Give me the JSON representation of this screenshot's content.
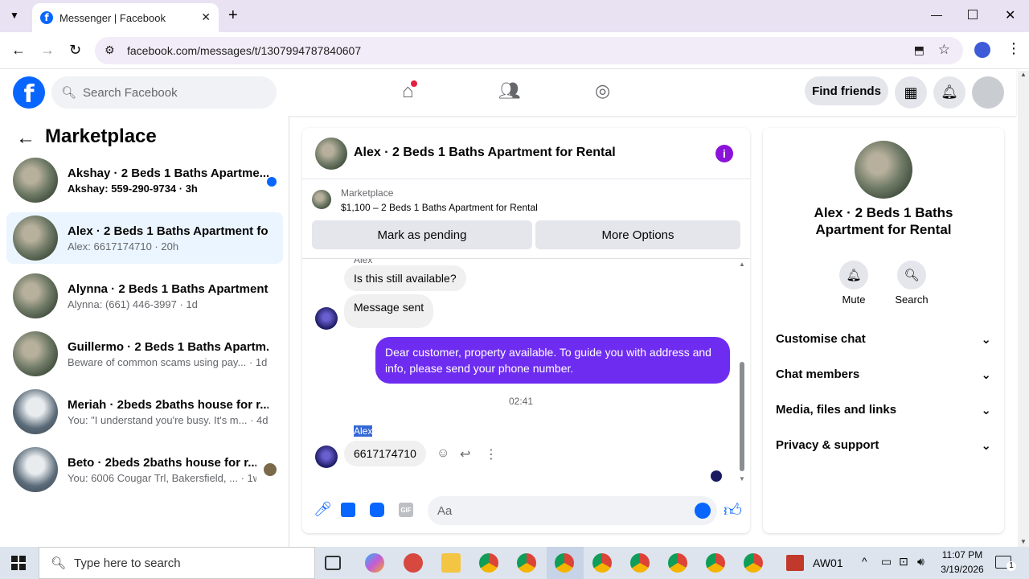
{
  "browser": {
    "tab_title": "Messenger | Facebook",
    "url": "facebook.com/messages/t/1307994787840607"
  },
  "fb": {
    "search_placeholder": "Search Facebook",
    "find_friends": "Find friends"
  },
  "left": {
    "title": "Marketplace",
    "conversations": [
      {
        "name": "Akshay · 2 Beds 1 Baths Apartme...",
        "preview": "Akshay: 559-290-9734 · 3h",
        "unread": true
      },
      {
        "name": "Alex · 2 Beds 1 Baths Apartment fo...",
        "preview": "Alex: 6617174710 · 20h",
        "selected": true
      },
      {
        "name": "Alynna · 2 Beds 1 Baths Apartment...",
        "preview": "Alynna: (661) 446-3997 · 1d"
      },
      {
        "name": "Guillermo · 2 Beds 1 Baths Apartm...",
        "preview": "Beware of common scams using pay... · 1d"
      },
      {
        "name": "Meriah · 2beds 2baths house for r...",
        "preview": "You: \"I understand you're busy. It's m... · 4d"
      },
      {
        "name": "Beto · 2beds 2baths house for r...",
        "preview": "You: 6006 Cougar Trl, Bakersfield, ... · 1w"
      }
    ]
  },
  "chat": {
    "title": "Alex · 2 Beds 1 Baths Apartment for Rental",
    "listing_source": "Marketplace",
    "listing_desc": "$1,100 – 2 Beds 1 Baths Apartment for Rental",
    "mark_pending": "Mark as pending",
    "more_options": "More Options",
    "sender_top": "Alex",
    "msg1": "Is this still available?",
    "msg2": "Message sent",
    "msg_out": "Dear customer, property available. To guide you with address and info, please send your phone number.",
    "time": "02:41",
    "sender": "Alex",
    "msg3": "6617174710",
    "input_placeholder": "Aa"
  },
  "info": {
    "title": "Alex · 2 Beds 1 Baths Apartment for Rental",
    "mute": "Mute",
    "search": "Search",
    "sections": [
      "Customise chat",
      "Chat members",
      "Media, files and links",
      "Privacy & support"
    ]
  },
  "taskbar": {
    "search_placeholder": "Type here to search",
    "user": "AW01",
    "time": "11:07 PM",
    "date": "3/19/2026",
    "notif_count": "1"
  },
  "colors": {
    "accent": "#0866ff",
    "bubble_out": "#6f2cf1",
    "selected_bg": "#ebf5ff"
  }
}
